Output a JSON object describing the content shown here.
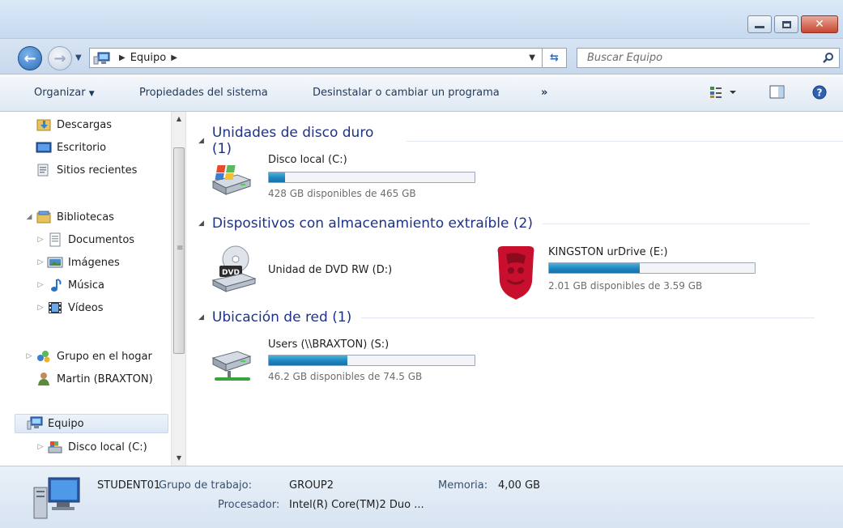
{
  "address": {
    "crumbs": [
      "Equipo"
    ],
    "search_placeholder": "Buscar Equipo"
  },
  "commands": {
    "organize": "Organizar",
    "system_properties": "Propiedades del sistema",
    "uninstall": "Desinstalar o cambiar un programa",
    "more": "»"
  },
  "nav": {
    "items": [
      {
        "label": "Descargas"
      },
      {
        "label": "Escritorio"
      },
      {
        "label": "Sitios recientes"
      },
      {
        "label": "Bibliotecas"
      },
      {
        "label": "Documentos"
      },
      {
        "label": "Imágenes"
      },
      {
        "label": "Música"
      },
      {
        "label": "Vídeos"
      },
      {
        "label": "Grupo en el hogar"
      },
      {
        "label": "Martin (BRAXTON)"
      },
      {
        "label": "Equipo"
      },
      {
        "label": "Disco local (C:)"
      }
    ]
  },
  "groups": [
    {
      "title": "Unidades de disco duro (1)"
    },
    {
      "title": "Dispositivos con almacenamiento extraíble (2)"
    },
    {
      "title": "Ubicación de red (1)"
    }
  ],
  "drives": {
    "c": {
      "name": "Disco local (C:)",
      "free_text": "428  GB disponibles de 465 GB",
      "used_fraction": 0.08
    },
    "d": {
      "name": "Unidad de DVD RW (D:)"
    },
    "e": {
      "name": "KINGSTON urDrive (E:)",
      "free_text": "2.01 GB disponibles de 3.59 GB",
      "used_fraction": 0.44
    },
    "s": {
      "name": "Users (\\\\BRAXTON) (S:)",
      "free_text": "46.2 GB disponibles de 74.5 GB",
      "used_fraction": 0.38
    }
  },
  "icons": {
    "dvd_label": "DVD"
  },
  "details": {
    "computer_name": "STUDENT01",
    "workgroup_label": "Grupo de trabajo:",
    "workgroup_value": "GROUP2",
    "memory_label": "Memoria:",
    "memory_value": "4,00 GB",
    "processor_label": "Procesador:",
    "processor_value": "Intel(R) Core(TM)2 Duo ..."
  },
  "colors": {
    "accent": "#1e3287",
    "bar_fill": "#1f8ac2"
  }
}
